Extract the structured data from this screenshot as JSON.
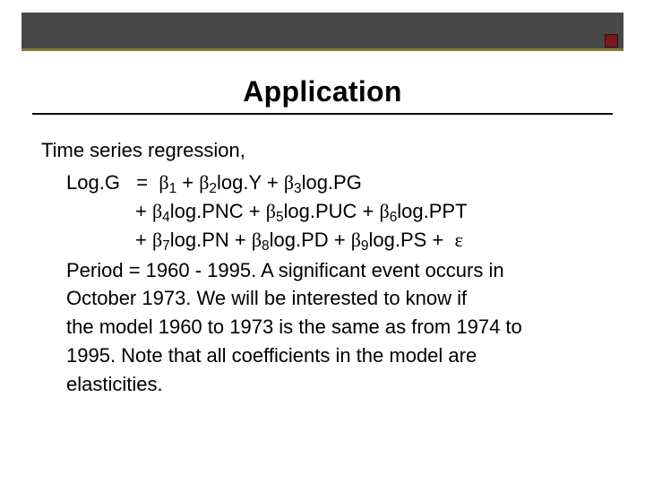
{
  "title": "Application",
  "lead": "Time series regression,",
  "eq": {
    "lhs": "Log.G",
    "eq_sign": "=",
    "line1_rhs_a": "1",
    "line1_rhs_b_txt": "log.Y + ",
    "line1_coef2": "2",
    "line1_rhs_c_txt": "log.PG",
    "line1_coef3": "3",
    "line2_prefix": "+ ",
    "line2_coef4": "4",
    "line2_txt_a": "log.PNC + ",
    "line2_coef5": "5",
    "line2_txt_b": "log.PUC + ",
    "line2_coef6": "6",
    "line2_txt_c": "log.PPT",
    "line3_prefix": "+ ",
    "line3_coef7": "7",
    "line3_txt_a": "log.PN + ",
    "line3_coef8": "8",
    "line3_txt_b": "log.PD + ",
    "line3_coef9": "9",
    "line3_txt_c": "log.PS + "
  },
  "period_label": "Period  =  1960 - 1995.",
  "period_tail": "  A significant event occurs in",
  "cont1": "October 1973.  We will be interested to know if",
  "cont2": "the model 1960 to 1973 is the same as from 1974 to",
  "cont3": "1995.  Note that all coefficients in the model are",
  "cont4": "elasticities."
}
